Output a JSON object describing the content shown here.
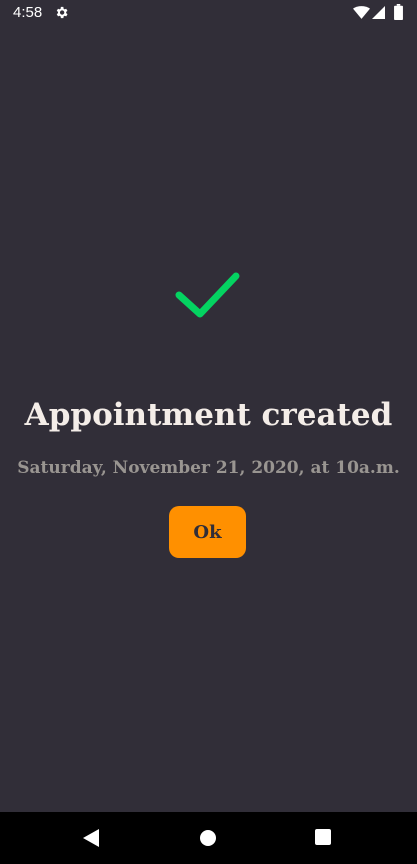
{
  "status_bar": {
    "time": "4:58",
    "icons": [
      "gear-icon",
      "wifi-icon",
      "signal-icon",
      "battery-icon"
    ]
  },
  "success_icon": "checkmark-icon",
  "title": "Appointment created",
  "subtitle": "Saturday, November 21, 2020, at 10a.m.",
  "ok_button": {
    "label": "Ok"
  },
  "nav_bar": {
    "icons": [
      "back-icon",
      "home-icon",
      "recents-icon"
    ]
  },
  "colors": {
    "background": "#312e38",
    "accent": "#ff9000",
    "success": "#04d361",
    "title_text": "#f4ede8",
    "subtitle_text": "#999591"
  }
}
